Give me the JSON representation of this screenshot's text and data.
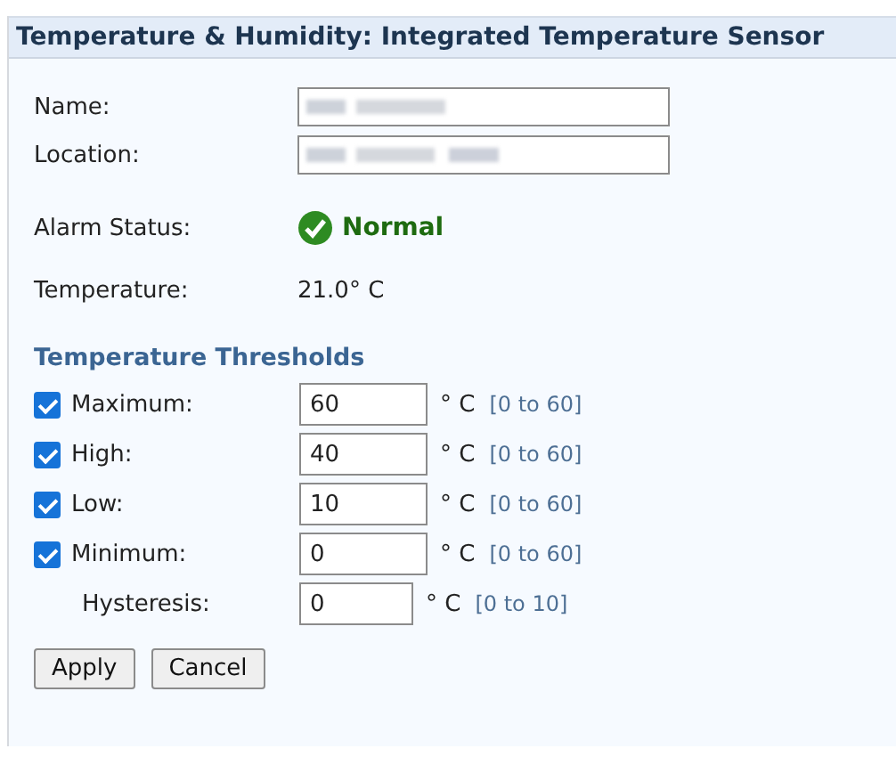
{
  "panel": {
    "title": "Temperature & Humidity: Integrated Temperature Sensor"
  },
  "fields": [
    {
      "label": "Name:",
      "kind": "redacted"
    },
    {
      "label": "Location:",
      "kind": "redacted"
    }
  ],
  "alarm_status": {
    "label": "Alarm Status:",
    "value": "Normal",
    "ok": true
  },
  "temperature": {
    "label": "Temperature:",
    "value": "21.0° C"
  },
  "thresholds": {
    "heading": "Temperature Thresholds",
    "items": [
      {
        "kind": "check",
        "label": "Maximum:",
        "checked": true,
        "value": "60",
        "unit": "° C",
        "range": "[0 to 60]"
      },
      {
        "kind": "check",
        "label": "High:",
        "checked": true,
        "value": "40",
        "unit": "° C",
        "range": "[0 to 60]"
      },
      {
        "kind": "check",
        "label": "Low:",
        "checked": true,
        "value": "10",
        "unit": "° C",
        "range": "[0 to 60]"
      },
      {
        "kind": "check",
        "label": "Minimum:",
        "checked": true,
        "value": "0",
        "unit": "° C",
        "range": "[0 to 60]"
      },
      {
        "kind": "plain",
        "label": "Hysteresis:",
        "value": "0",
        "unit": "° C",
        "range": "[0 to 10]"
      }
    ]
  },
  "buttons": [
    "Apply",
    "Cancel"
  ]
}
